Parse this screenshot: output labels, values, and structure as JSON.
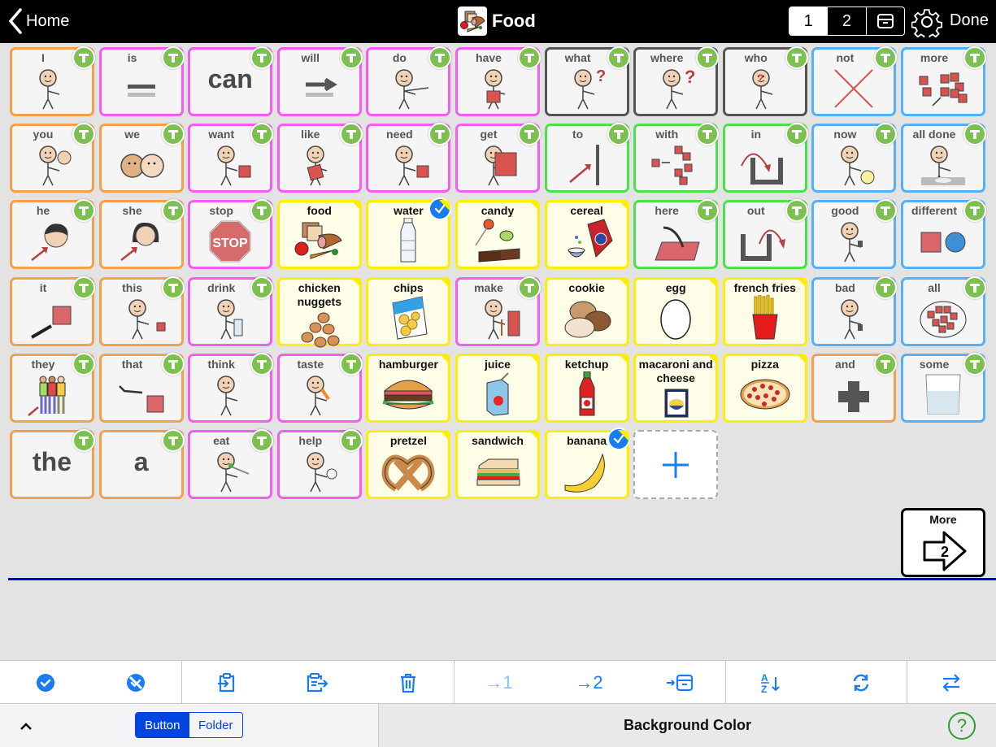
{
  "topbar": {
    "back_label": "Home",
    "title": "Food",
    "pages": [
      "1",
      "2"
    ],
    "active_page": "1",
    "done_label": "Done"
  },
  "colors": {
    "pronoun": "#f5a04b",
    "verb": "#f55cf0",
    "question": "#555555",
    "preposition": "#4de04d",
    "descriptor": "#56b0f5",
    "food": "#ffee00",
    "accent": "#1a7cf2"
  },
  "grid": {
    "rows": [
      [
        {
          "label": "I",
          "cat": "pronoun",
          "icon": "person-pointing-self-icon",
          "badge": "T"
        },
        {
          "label": "is",
          "cat": "verb",
          "icon": "equals-icon",
          "badge": "T"
        },
        {
          "label": "",
          "big": "can",
          "cat": "verb",
          "icon": "",
          "badge": "T"
        },
        {
          "label": "will",
          "cat": "verb",
          "icon": "arrow-equals-icon",
          "badge": "T"
        },
        {
          "label": "do",
          "cat": "verb",
          "icon": "person-reaching-icon",
          "badge": "T"
        },
        {
          "label": "have",
          "cat": "verb",
          "icon": "person-holding-box-icon",
          "badge": "T"
        },
        {
          "label": "what",
          "cat": "question",
          "icon": "person-question-icon",
          "badge": "T"
        },
        {
          "label": "where",
          "cat": "question",
          "icon": "person-looking-question-icon",
          "badge": "T"
        },
        {
          "label": "who",
          "cat": "question",
          "icon": "question-face-icon",
          "badge": "T"
        },
        {
          "label": "not",
          "cat": "descriptor",
          "icon": "red-x-icon",
          "badge": "T"
        },
        {
          "label": "more",
          "cat": "descriptor",
          "icon": "many-squares-icon",
          "badge": "T"
        }
      ],
      [
        {
          "label": "you",
          "cat": "pronoun",
          "icon": "two-people-pointing-icon",
          "badge": "T"
        },
        {
          "label": "we",
          "cat": "pronoun",
          "icon": "two-faces-icon",
          "badge": "T"
        },
        {
          "label": "want",
          "cat": "verb",
          "icon": "person-reaching-box-icon",
          "badge": "T"
        },
        {
          "label": "like",
          "cat": "verb",
          "icon": "person-hugging-box-icon",
          "badge": "T"
        },
        {
          "label": "need",
          "cat": "verb",
          "icon": "hands-reaching-box-icon",
          "badge": "T"
        },
        {
          "label": "get",
          "cat": "verb",
          "icon": "hands-grabbing-box-icon",
          "badge": "T"
        },
        {
          "label": "to",
          "cat": "preposition",
          "icon": "arrow-to-line-icon",
          "badge": "T"
        },
        {
          "label": "with",
          "cat": "preposition",
          "icon": "squares-join-icon",
          "badge": "T"
        },
        {
          "label": "in",
          "cat": "preposition",
          "icon": "arrow-into-container-icon",
          "badge": "T"
        },
        {
          "label": "now",
          "cat": "descriptor",
          "icon": "person-clock-icon",
          "badge": "T"
        },
        {
          "label": "all done",
          "cat": "descriptor",
          "icon": "person-empty-plate-icon",
          "badge": "T"
        }
      ],
      [
        {
          "label": "he",
          "cat": "pronoun",
          "icon": "boy-face-icon",
          "badge": "T"
        },
        {
          "label": "she",
          "cat": "pronoun",
          "icon": "girl-face-icon",
          "badge": "T"
        },
        {
          "label": "stop",
          "cat": "verb",
          "icon": "stop-sign-icon",
          "badge": "T"
        },
        {
          "label": "food",
          "cat": "food",
          "icon": "food-group-icon"
        },
        {
          "label": "water",
          "cat": "food",
          "icon": "water-bottle-icon",
          "checked": true
        },
        {
          "label": "candy",
          "cat": "food",
          "icon": "candy-icon"
        },
        {
          "label": "cereal",
          "cat": "food",
          "icon": "cereal-box-icon"
        },
        {
          "label": "here",
          "cat": "preposition",
          "icon": "pointing-at-mat-icon",
          "badge": "T"
        },
        {
          "label": "out",
          "cat": "preposition",
          "icon": "arrow-out-of-container-icon",
          "badge": "T"
        },
        {
          "label": "good",
          "cat": "descriptor",
          "icon": "thumbs-up-person-icon",
          "badge": "T"
        },
        {
          "label": "different",
          "cat": "descriptor",
          "icon": "square-and-circle-icon",
          "badge": "T"
        }
      ],
      [
        {
          "label": "it",
          "cat": "pronoun",
          "icon": "hand-pointing-square-icon",
          "badge": "T"
        },
        {
          "label": "this",
          "cat": "pronoun",
          "icon": "person-pointing-square-icon",
          "badge": "T"
        },
        {
          "label": "drink",
          "cat": "verb",
          "icon": "person-drinking-icon",
          "badge": "T"
        },
        {
          "label": "chicken nuggets",
          "cat": "food",
          "icon": "chicken-nuggets-icon"
        },
        {
          "label": "chips",
          "cat": "food",
          "icon": "chips-bag-icon"
        },
        {
          "label": "make",
          "cat": "verb",
          "icon": "person-hammering-icon",
          "badge": "T"
        },
        {
          "label": "cookie",
          "cat": "food",
          "icon": "cookies-icon"
        },
        {
          "label": "egg",
          "cat": "food",
          "icon": "egg-icon"
        },
        {
          "label": "french fries",
          "cat": "food",
          "icon": "french-fries-icon"
        },
        {
          "label": "bad",
          "cat": "descriptor",
          "icon": "thumbs-down-person-icon",
          "badge": "T"
        },
        {
          "label": "all",
          "cat": "descriptor",
          "icon": "circled-squares-icon",
          "badge": "T"
        }
      ],
      [
        {
          "label": "they",
          "cat": "pronoun",
          "icon": "group-people-icon",
          "badge": "T"
        },
        {
          "label": "that",
          "cat": "pronoun",
          "icon": "pointing-far-square-icon",
          "badge": "T"
        },
        {
          "label": "think",
          "cat": "verb",
          "icon": "person-thinking-icon",
          "badge": "T"
        },
        {
          "label": "taste",
          "cat": "verb",
          "icon": "person-tasting-icon",
          "badge": "T"
        },
        {
          "label": "hamburger",
          "cat": "food",
          "icon": "hamburger-icon"
        },
        {
          "label": "juice",
          "cat": "food",
          "icon": "juice-box-icon"
        },
        {
          "label": "ketchup",
          "cat": "food",
          "icon": "ketchup-bottle-icon"
        },
        {
          "label": "macaroni and cheese",
          "cat": "food",
          "icon": "mac-and-cheese-icon"
        },
        {
          "label": "pizza",
          "cat": "food",
          "icon": "pizza-icon"
        },
        {
          "label": "and",
          "cat": "pronoun",
          "icon": "plus-sign-icon",
          "badge": "T"
        },
        {
          "label": "some",
          "cat": "descriptor",
          "icon": "half-glass-icon",
          "badge": "T"
        }
      ],
      [
        {
          "label": "",
          "big": "the",
          "cat": "pronoun",
          "icon": "",
          "badge": "T"
        },
        {
          "label": "",
          "big": "a",
          "cat": "pronoun",
          "icon": "",
          "badge": "T"
        },
        {
          "label": "eat",
          "cat": "verb",
          "icon": "person-eating-icon",
          "badge": "T"
        },
        {
          "label": "help",
          "cat": "verb",
          "icon": "person-helping-icon",
          "badge": "T"
        },
        {
          "label": "pretzel",
          "cat": "food",
          "icon": "pretzel-icon"
        },
        {
          "label": "sandwich",
          "cat": "food",
          "icon": "sandwich-icon"
        },
        {
          "label": "banana",
          "cat": "food",
          "icon": "banana-icon",
          "checked": true
        }
      ]
    ]
  },
  "more_button": {
    "label": "More",
    "page": "2"
  },
  "toolbar": {
    "buttons": [
      {
        "name": "select-all",
        "icon": "check-circle-icon"
      },
      {
        "name": "deselect-all",
        "icon": "check-circle-slash-icon"
      },
      {
        "name": "paste",
        "icon": "clipboard-in-icon"
      },
      {
        "name": "copy",
        "icon": "clipboard-out-icon"
      },
      {
        "name": "delete",
        "icon": "trash-icon"
      },
      {
        "name": "move-to-page-1",
        "icon": "arrow-1-icon",
        "text": "→1"
      },
      {
        "name": "move-to-page-2",
        "icon": "arrow-2-icon",
        "text": "→2"
      },
      {
        "name": "move-to-storage",
        "icon": "arrow-archive-icon"
      },
      {
        "name": "sort-alpha",
        "icon": "sort-az-icon"
      },
      {
        "name": "refresh",
        "icon": "refresh-icon"
      },
      {
        "name": "swap",
        "icon": "swap-arrows-icon"
      }
    ]
  },
  "bottom": {
    "segments": [
      "Button",
      "Folder"
    ],
    "active_segment": "Button",
    "panel_title": "Background Color",
    "help": "?"
  }
}
